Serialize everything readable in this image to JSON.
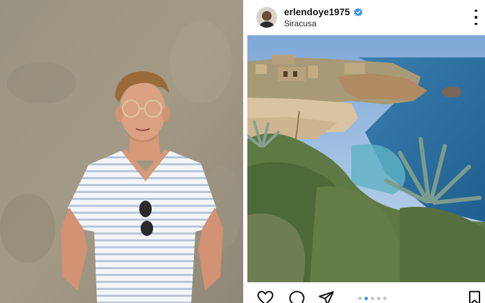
{
  "post": {
    "username": "erlendoye1975",
    "location": "Siracusa",
    "verified": true,
    "carousel": {
      "total": 5,
      "active_index": 1
    }
  },
  "icons": {
    "more": "more-options-icon",
    "like": "heart-icon",
    "comment": "comment-icon",
    "share": "paper-plane-icon",
    "save": "bookmark-icon",
    "verified": "verified-badge-icon"
  },
  "colors": {
    "verified_blue": "#3897f0",
    "dot_active": "#3897f0",
    "dot_inactive": "#c7c7c7",
    "text": "#111111"
  }
}
